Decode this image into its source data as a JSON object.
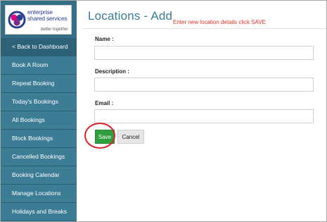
{
  "brand": {
    "name": "enterprise shared services",
    "tagline": "better together"
  },
  "sidebar": {
    "items": [
      {
        "label": "< Back to Dashboard"
      },
      {
        "label": "Book A Room"
      },
      {
        "label": "Repeat Booking"
      },
      {
        "label": "Today's Bookings"
      },
      {
        "label": "All Bookings"
      },
      {
        "label": "Block Bookings"
      },
      {
        "label": "Cancelled Bookings"
      },
      {
        "label": "Booking Calendar"
      },
      {
        "label": "Manage Locations"
      },
      {
        "label": "Holidays and Breaks"
      }
    ]
  },
  "page": {
    "title": "Locations - Add",
    "annotation": "Enter new location details click SAVE"
  },
  "form": {
    "name_label": "Name :",
    "name_value": "",
    "description_label": "Description :",
    "description_value": "",
    "email_label": "Email :",
    "email_value": "",
    "save_label": "Save",
    "cancel_label": "Cancel"
  },
  "colors": {
    "sidebar": "#356f86",
    "title": "#3a7b96",
    "annotation": "#e0332a",
    "save_button": "#2e9e3f",
    "highlight_circle": "#d8232a"
  }
}
